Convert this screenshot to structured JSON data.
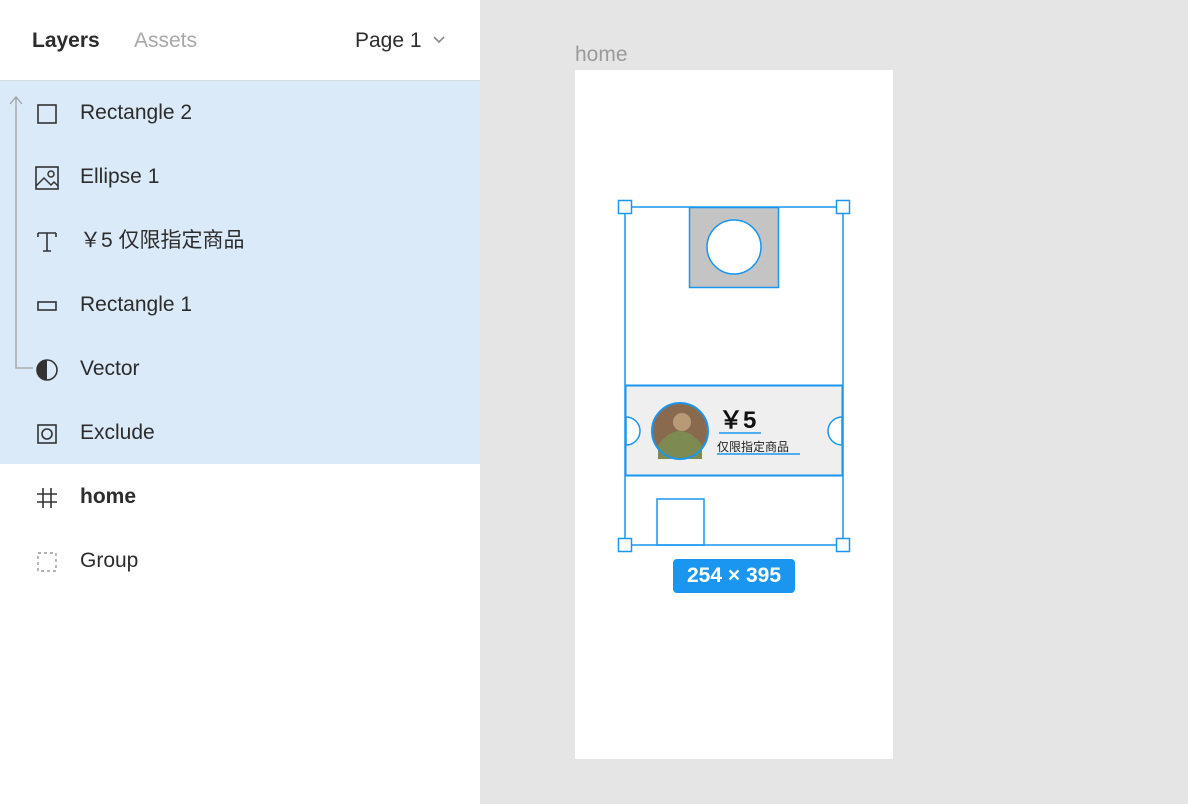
{
  "header": {
    "tabs": {
      "layers": "Layers",
      "assets": "Assets"
    },
    "page_select": "Page 1"
  },
  "layers": [
    {
      "label": "Rectangle 2",
      "icon": "rectangle-icon"
    },
    {
      "label": "Ellipse 1",
      "icon": "image-icon"
    },
    {
      "label": "￥5 仅限指定商品",
      "icon": "text-icon"
    },
    {
      "label": "Rectangle 1",
      "icon": "thin-rectangle-icon"
    },
    {
      "label": "Vector",
      "icon": "half-circle-icon"
    },
    {
      "label": "Exclude",
      "icon": "exclude-icon"
    },
    {
      "label": "home",
      "icon": "frame-hash-icon"
    },
    {
      "label": "Group",
      "icon": "group-dashed-icon"
    }
  ],
  "canvas": {
    "frame_label": "home",
    "coupon": {
      "price": "￥5",
      "subtitle": "仅限指定商品"
    },
    "size_badge": "254 × 395"
  },
  "colors": {
    "selection_bg": "#dbeaf8",
    "accent_blue": "#1a96f0",
    "canvas_bg": "#e5e5e5"
  }
}
